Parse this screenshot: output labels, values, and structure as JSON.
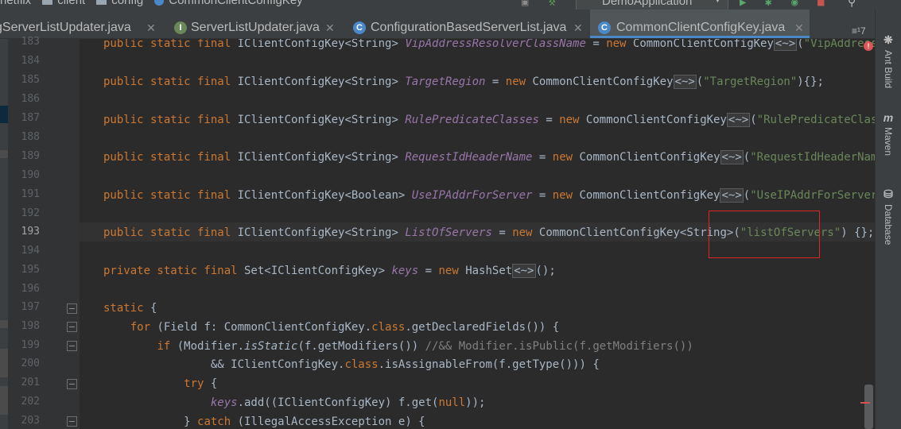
{
  "breadcrumbs": {
    "items": [
      "netflix",
      "client",
      "config",
      "CommonClientConfigKey"
    ]
  },
  "run_config": {
    "label": "DemoApplication"
  },
  "tabs": [
    {
      "label": "gServerListUpdater.java",
      "icon": "interface-icon",
      "icon_letter": "",
      "color": "#6e9ec6",
      "active": false
    },
    {
      "label": "ServerListUpdater.java",
      "icon": "interface-icon",
      "icon_letter": "I",
      "color": "#6a8759",
      "active": false
    },
    {
      "label": "ConfigurationBasedServerList.java",
      "icon": "class-icon",
      "icon_letter": "C",
      "color": "#4a88c7",
      "active": false
    },
    {
      "label": "CommonClientConfigKey.java",
      "icon": "class-icon",
      "icon_letter": "C",
      "color": "#4a88c7",
      "active": true
    }
  ],
  "tab_overflow": {
    "label": "≡¹7"
  },
  "tool_windows": [
    {
      "label": "Ant Build",
      "icon": "ant-icon"
    },
    {
      "label": "Maven",
      "icon": "maven-icon",
      "glyph": "m"
    },
    {
      "label": "Database",
      "icon": "database-icon"
    }
  ],
  "lines": [
    {
      "n": "183",
      "code": "<span class='kw'>public static final</span> IClientConfigKey&lt;String&gt; <span class='fld'>VipAddressResolverClassName</span> = <span class='kw'>new</span> CommonClientConfigKey<span class='diamond'>&lt;~&gt;</span>(<span class='str'>\"VipAddressResol</span>"
    },
    {
      "n": "184",
      "code": ""
    },
    {
      "n": "185",
      "code": "<span class='kw'>public static final</span> IClientConfigKey&lt;String&gt; <span class='fld'>TargetRegion</span> = <span class='kw'>new</span> CommonClientConfigKey<span class='diamond'>&lt;~&gt;</span>(<span class='str'>\"TargetRegion\"</span>){};"
    },
    {
      "n": "186",
      "code": ""
    },
    {
      "n": "187",
      "code": "<span class='kw'>public static final</span> IClientConfigKey&lt;String&gt; <span class='fld'>RulePredicateClasses</span> = <span class='kw'>new</span> CommonClientConfigKey<span class='diamond'>&lt;~&gt;</span>(<span class='str'>\"RulePredicateClasses\"</span>){"
    },
    {
      "n": "188",
      "code": ""
    },
    {
      "n": "189",
      "code": "<span class='kw'>public static final</span> IClientConfigKey&lt;String&gt; <span class='fld'>RequestIdHeaderName</span> = <span class='kw'>new</span> CommonClientConfigKey<span class='diamond'>&lt;~&gt;</span>(<span class='str'>\"RequestIdHeaderName\"</span>) {}"
    },
    {
      "n": "190",
      "code": ""
    },
    {
      "n": "191",
      "code": "<span class='kw'>public static final</span> IClientConfigKey&lt;Boolean&gt; <span class='fld'>UseIPAddrForServer</span> = <span class='kw'>new</span> CommonClientConfigKey<span class='diamond'>&lt;~&gt;</span>(<span class='str'>\"UseIPAddrForServer\"</span>) {};"
    },
    {
      "n": "192",
      "code": ""
    },
    {
      "n": "193",
      "code": "<span class='kw'>public static final</span> IClientConfigKey&lt;String&gt; <span class='fld'>ListOfServers</span> = <span class='kw'>new</span> CommonClientConfigKey&lt;String&gt;(<span class='str'>\"listOfServers\"</span>) {};"
    },
    {
      "n": "194",
      "code": ""
    },
    {
      "n": "195",
      "code": "<span class='kw'>private static final</span> Set&lt;IClientConfigKey&gt; <span class='fld'>keys</span> = <span class='kw'>new</span> HashSet<span class='diamond'>&lt;~&gt;</span>();"
    },
    {
      "n": "196",
      "code": ""
    },
    {
      "n": "197",
      "code": "<span class='kw'>static</span> {"
    },
    {
      "n": "198",
      "code": "    <span class='kw'>for</span> (Field f: CommonClientConfigKey.<span class='kw'>class</span>.getDeclaredFields()) {"
    },
    {
      "n": "199",
      "code": "        <span class='kw'>if</span> (Modifier.<i>isStatic</i>(f.getModifiers()) <span class='cmt'>//&amp;&amp; Modifier.isPublic(f.getModifiers())</span>"
    },
    {
      "n": "200",
      "code": "                &amp;&amp; IClientConfigKey.<span class='kw'>class</span>.isAssignableFrom(f.getType())) {"
    },
    {
      "n": "201",
      "code": "            <span class='kw'>try</span> {"
    },
    {
      "n": "202",
      "code": "                <span class='fld'>keys</span>.add((IClientConfigKey) f.get(<span class='kw'>null</span>));"
    },
    {
      "n": "203",
      "code": "            } <span class='kw'>catch</span> (IllegalAccessException e) {"
    }
  ],
  "current_line": "193",
  "colors": {
    "keyword": "#cc7832",
    "field": "#9876aa",
    "string": "#6a8759",
    "comment": "#808080",
    "highlight": "#e02424",
    "accent": "#4a88c7"
  }
}
